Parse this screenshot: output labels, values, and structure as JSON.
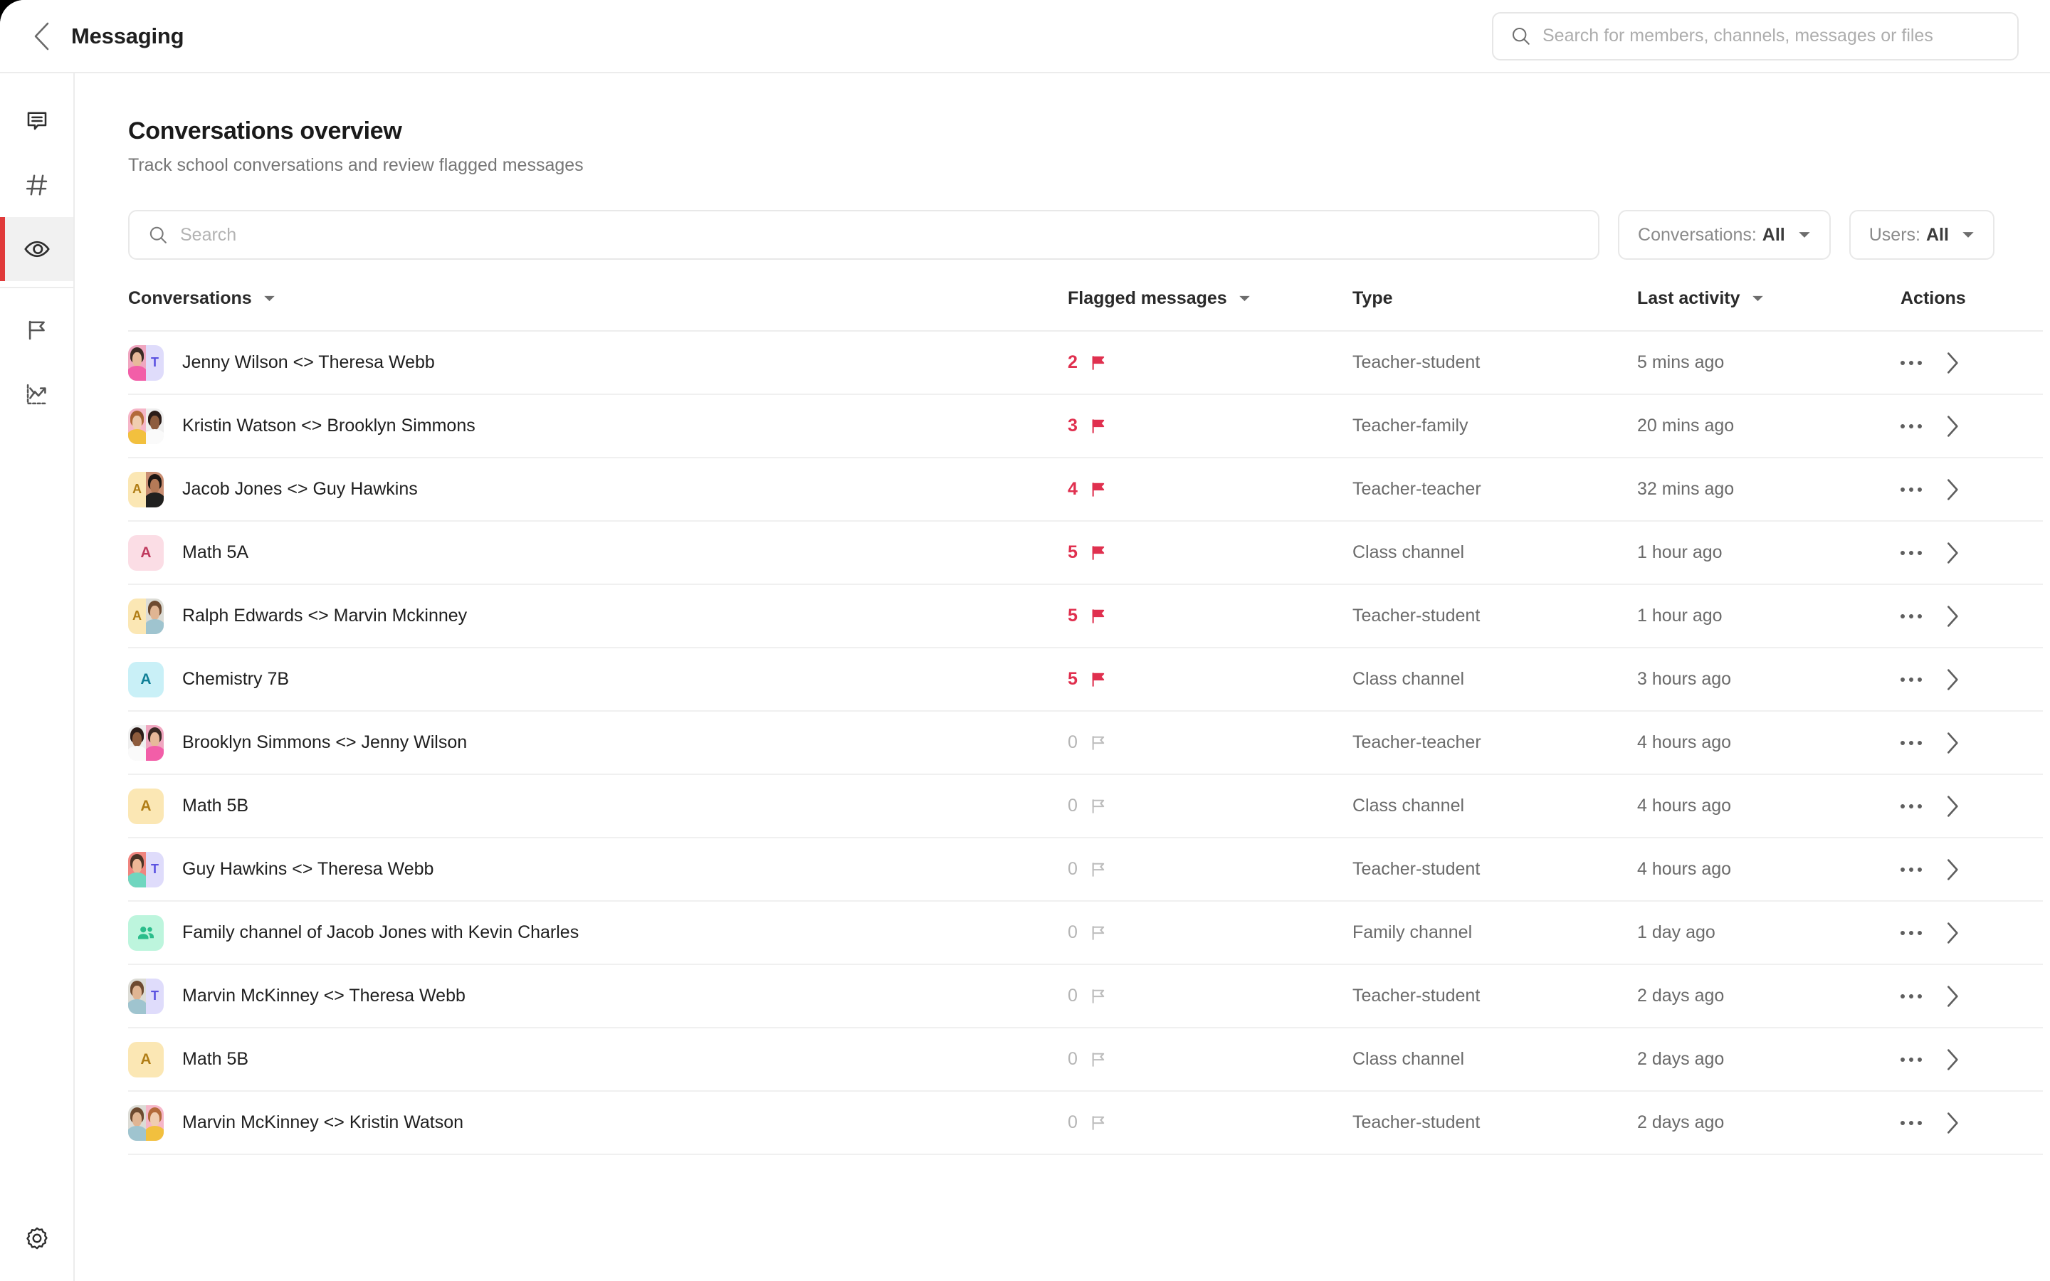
{
  "topbar": {
    "back_icon": "chevron-left-icon",
    "title": "Messaging",
    "search_icon": "search-icon",
    "search_value": "",
    "search_placeholder": "Search for members, channels, messages or files"
  },
  "rail": {
    "items": [
      {
        "icon": "chat-bubble-icon",
        "name": "messages",
        "active": false
      },
      {
        "icon": "hashtag-icon",
        "name": "channels",
        "active": false
      },
      {
        "icon": "eye-icon",
        "name": "oversight",
        "active": true
      },
      {
        "icon": "flag-icon",
        "name": "flagged",
        "active": false
      },
      {
        "icon": "analytics-chart-icon",
        "name": "analytics",
        "active": false
      }
    ],
    "bottom": {
      "icon": "gear-icon",
      "name": "settings"
    }
  },
  "page": {
    "title": "Conversations overview",
    "subtitle": "Track school conversations and review flagged messages"
  },
  "toolbar": {
    "search_icon": "search-icon",
    "search_value": "",
    "search_placeholder": "Search",
    "filters": [
      {
        "label": "Conversations:",
        "value": "All",
        "icon": "chevron-down-icon"
      },
      {
        "label": "Users:",
        "value": "All",
        "icon": "chevron-down-icon"
      }
    ]
  },
  "table": {
    "columns": [
      {
        "label": "Conversations",
        "sortable": true
      },
      {
        "label": "Flagged messages",
        "sortable": true
      },
      {
        "label": "Type",
        "sortable": false
      },
      {
        "label": "Last activity",
        "sortable": true
      },
      {
        "label": "Actions",
        "sortable": false
      }
    ],
    "rows": [
      {
        "name": "Jenny Wilson <> Theresa Webb",
        "flagged": 2,
        "type": "Teacher-student",
        "activity": "5 mins ago",
        "avatar": {
          "kind": "pair",
          "left": {
            "photo": true,
            "bg": "#f0a6c0",
            "hair": "#3a2a24",
            "skin": "#e7b99a",
            "body": "#f25ea8"
          },
          "right": {
            "letter": "T",
            "bg": "#dfdcfb",
            "fg": "#5b52e0"
          }
        }
      },
      {
        "name": "Kristin Watson <> Brooklyn Simmons",
        "flagged": 3,
        "type": "Teacher-family",
        "activity": "20 mins ago",
        "avatar": {
          "kind": "pair",
          "left": {
            "photo": true,
            "bg": "#f6b6c8",
            "hair": "#b36a3a",
            "skin": "#f0cdb0",
            "body": "#f2c03e"
          },
          "right": {
            "photo": true,
            "bg": "#efefef",
            "hair": "#2b1c18",
            "skin": "#8e5c3d",
            "body": "#fafafa"
          }
        }
      },
      {
        "name": "Jacob Jones <> Guy Hawkins",
        "flagged": 4,
        "type": "Teacher-teacher",
        "activity": "32 mins ago",
        "avatar": {
          "kind": "pair",
          "left": {
            "letter": "A",
            "bg": "#fbe7b4",
            "fg": "#b07d15"
          },
          "right": {
            "photo": true,
            "bg": "#c98e72",
            "hair": "#1d1612",
            "skin": "#b57a57",
            "body": "#20201f"
          }
        }
      },
      {
        "name": "Math 5A",
        "flagged": 5,
        "type": "Class channel",
        "activity": "1 hour ago",
        "avatar": {
          "kind": "single",
          "letter": "A",
          "bg": "#fbdde5",
          "fg": "#c03a5e"
        }
      },
      {
        "name": "Ralph Edwards <> Marvin Mckinney",
        "flagged": 5,
        "type": "Teacher-student",
        "activity": "1 hour ago",
        "avatar": {
          "kind": "pair",
          "left": {
            "letter": "A",
            "bg": "#fbe7b4",
            "fg": "#b07d15"
          },
          "right": {
            "photo": true,
            "bg": "#dcdcd6",
            "hair": "#6d4a30",
            "skin": "#e0b593",
            "body": "#9fc4cf"
          }
        }
      },
      {
        "name": "Chemistry 7B",
        "flagged": 5,
        "type": "Class channel",
        "activity": "3 hours ago",
        "avatar": {
          "kind": "single",
          "letter": "A",
          "bg": "#c9f0f7",
          "fg": "#0f7f96"
        }
      },
      {
        "name": "Brooklyn Simmons <> Jenny Wilson",
        "flagged": 0,
        "type": "Teacher-teacher",
        "activity": "4 hours ago",
        "avatar": {
          "kind": "pair",
          "left": {
            "photo": true,
            "bg": "#efefef",
            "hair": "#2b1c18",
            "skin": "#8e5c3d",
            "body": "#fafafa"
          },
          "right": {
            "photo": true,
            "bg": "#f0a6c0",
            "hair": "#3a2a24",
            "skin": "#e7b99a",
            "body": "#f25ea8"
          }
        }
      },
      {
        "name": "Math 5B",
        "flagged": 0,
        "type": "Class channel",
        "activity": "4 hours ago",
        "avatar": {
          "kind": "single",
          "letter": "A",
          "bg": "#fbe7b4",
          "fg": "#b07d15"
        }
      },
      {
        "name": "Guy Hawkins <> Theresa Webb",
        "flagged": 0,
        "type": "Teacher-student",
        "activity": "4 hours ago",
        "avatar": {
          "kind": "pair",
          "left": {
            "photo": true,
            "bg": "#f0857f",
            "hair": "#4a3326",
            "skin": "#edb897",
            "body": "#6fd6bf"
          },
          "right": {
            "letter": "T",
            "bg": "#dfdcfb",
            "fg": "#5b52e0"
          }
        }
      },
      {
        "name": "Family channel of Jacob Jones with Kevin Charles",
        "flagged": 0,
        "type": "Family channel",
        "activity": "1 day ago",
        "avatar": {
          "kind": "icon",
          "icon": "people-icon",
          "bg": "#bdf5dd",
          "fg": "#2bbd8b"
        }
      },
      {
        "name": "Marvin McKinney <> Theresa Webb",
        "flagged": 0,
        "type": "Teacher-student",
        "activity": "2 days ago",
        "avatar": {
          "kind": "pair",
          "left": {
            "photo": true,
            "bg": "#dcdcd6",
            "hair": "#6d4a30",
            "skin": "#e0b593",
            "body": "#9fc4cf"
          },
          "right": {
            "letter": "T",
            "bg": "#dfdcfb",
            "fg": "#5b52e0"
          }
        }
      },
      {
        "name": "Math 5B",
        "flagged": 0,
        "type": "Class channel",
        "activity": "2 days ago",
        "avatar": {
          "kind": "single",
          "letter": "A",
          "bg": "#fbe7b4",
          "fg": "#b07d15"
        }
      },
      {
        "name": "Marvin McKinney <> Kristin Watson",
        "flagged": 0,
        "type": "Teacher-student",
        "activity": "2 days ago",
        "avatar": {
          "kind": "pair",
          "left": {
            "photo": true,
            "bg": "#dcdcd6",
            "hair": "#6d4a30",
            "skin": "#e0b593",
            "body": "#9fc4cf"
          },
          "right": {
            "photo": true,
            "bg": "#f6b6c8",
            "hair": "#b36a3a",
            "skin": "#f0cdb0",
            "body": "#f2c03e"
          }
        }
      }
    ],
    "row_actions": {
      "menu_icon": "ellipsis-icon",
      "open_icon": "chevron-right-icon"
    },
    "flag_icon_filled": "flag-filled-icon",
    "flag_icon_outline": "flag-outline-icon"
  },
  "colors": {
    "accent_red": "#e03a3a",
    "flag_red": "#e0304f",
    "muted": "#6b6b6b"
  }
}
